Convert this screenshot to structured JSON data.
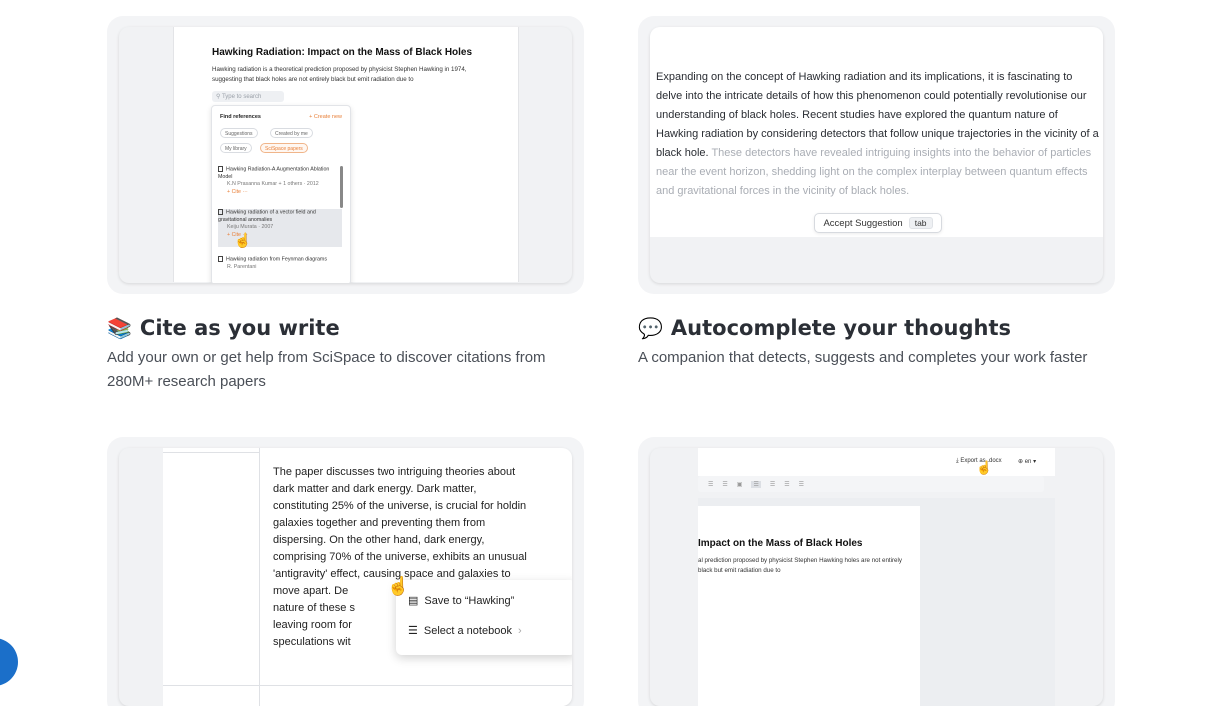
{
  "features": [
    {
      "emoji": "📚",
      "title": "Cite as you write",
      "desc_line1": "Add your own or get help from SciSpace to discover citations from",
      "desc_line2": "280M+ research papers",
      "preview": {
        "doc_title": "Hawking Radiation: Impact on the Mass of Black Holes",
        "doc_text": "Hawking radiation is a theoretical prediction proposed by physicist Stephen Hawking in 1974, suggesting that black holes are not entirely black but emit radiation due to",
        "search_placeholder": "Type to search",
        "panel_title": "Find references",
        "create_new": "+ Create new",
        "chips": [
          "Suggestions",
          "Created by me",
          "My library",
          "SciSpace papers"
        ],
        "refs": [
          {
            "title": "Hawking Radiation-A Augmentation Ablation Model",
            "meta": "K.N Prasanna Kumar + 1 others · 2012",
            "cite": "+ Cite   ···"
          },
          {
            "title": "Hawking radiation of a vector field and gravitational anomalies",
            "meta": "Keiju Murata · 2007",
            "cite": "+ Cite   ···"
          },
          {
            "title": "Hawking radiation from Feynman diagrams",
            "meta": "R. Parentani",
            "cite": ""
          }
        ]
      }
    },
    {
      "emoji": "💬",
      "title": "Autocomplete your thoughts",
      "desc_line1": "A companion that detects, suggests and completes your work faster",
      "preview": {
        "text": "Expanding on the concept of Hawking radiation and its implications, it is fascinating to delve into the intricate details of how this phenomenon could potentially revolutionise our understanding of black holes. Recent studies have explored the quantum nature of Hawking radiation by considering detectors that follow unique trajectories in the vicinity of a black hole.",
        "suggestion": " These detectors have revealed intriguing insights into the behavior of particles near the event horizon, shedding light on the complex interplay between quantum effects and gravitational forces in the vicinity of black holes.",
        "accept_label": "Accept Suggestion",
        "accept_key": "tab"
      }
    },
    {
      "preview": {
        "text": "The paper discusses two intriguing theories about\ndark matter and dark energy. Dark matter,\nconstituting 25% of the universe, is crucial for holdin\ngalaxies together and preventing them from\ndispersing. On the other hand, dark energy,\ncomprising 70% of the universe, exhibits an unusual\n'antigravity' effect, causing space and galaxies to\nmove apart. De\nnature of these s\nleaving room for\nspeculations wit",
        "menu_save": "Save to “Hawking”",
        "menu_notebook": "Select a notebook"
      }
    },
    {
      "preview": {
        "export_label": "Export as .docx",
        "lang_label": "en",
        "doc_title": "Impact on the Mass of Black Holes",
        "doc_text": "al prediction proposed by physicist Stephen Hawking holes are not entirely black but emit radiation due to"
      }
    }
  ]
}
